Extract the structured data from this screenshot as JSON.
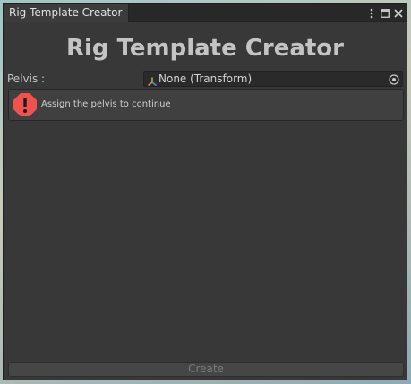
{
  "window": {
    "tab_title": "Rig Template Creator"
  },
  "header": {
    "title": "Rig Template Creator"
  },
  "pelvis_field": {
    "label": "Pelvis :",
    "value": "None (Transform)",
    "icon": "transform-axis-icon",
    "picker_icon": "object-picker-icon"
  },
  "helpbox": {
    "icon": "error-icon",
    "message": "Assign the pelvis to continue"
  },
  "footer": {
    "create_label": "Create"
  },
  "colors": {
    "window_bg": "#383838",
    "error_red": "#f0534f",
    "disabled_text": "#7a7a7a"
  }
}
